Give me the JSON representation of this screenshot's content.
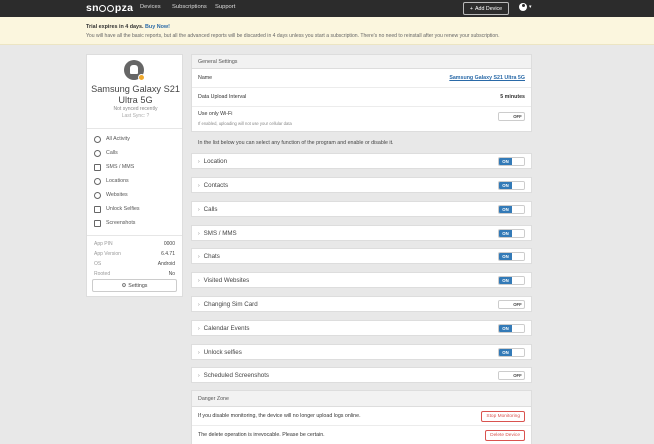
{
  "nav": {
    "logo": "snoopza",
    "links": [
      "Devices",
      "Subscriptions",
      "Support"
    ],
    "add_device": "Add Device",
    "add_icon": "+"
  },
  "banner": {
    "title": "Trial expires in 4 days.",
    "buy": "Buy Now!",
    "message": "You will have all the basic reports, but all the advanced reports will be discarded in 4 days unless you start a subscription. There's no need to reinstall after you renew your subscription."
  },
  "device": {
    "name": "Samsung Galaxy S21 Ultra 5G",
    "status": "Not synced recently",
    "last_sync": "Last Sync: ?",
    "icon": "android-icon"
  },
  "sidebar": {
    "items": [
      {
        "label": "All Activity",
        "icon": "clock-icon"
      },
      {
        "label": "Calls",
        "icon": "phone-icon"
      },
      {
        "label": "SMS / MMS",
        "icon": "message-icon"
      },
      {
        "label": "Locations",
        "icon": "location-icon"
      },
      {
        "label": "Websites",
        "icon": "globe-icon"
      },
      {
        "label": "Unlock Selfies",
        "icon": "camera-icon"
      },
      {
        "label": "Screenshots",
        "icon": "screen-icon"
      }
    ],
    "info": [
      {
        "key": "App PIN",
        "value": "0000"
      },
      {
        "key": "App Version",
        "value": "6.4.71"
      },
      {
        "key": "OS",
        "value": "Android"
      },
      {
        "key": "Rooted",
        "value": "No"
      }
    ],
    "settings_label": "Settings",
    "settings_icon": "⚙"
  },
  "general": {
    "header": "General Settings",
    "name_label": "Name",
    "name_value": "Samsung Galaxy S21 Ultra 5G",
    "interval_label": "Data Upload Interval",
    "interval_value": "5 minutes",
    "wifi_label": "Use only Wi-Fi",
    "wifi_hint": "If enabled, uploading will not use your cellular data",
    "wifi_state": "OFF"
  },
  "intro": "In the list below you can select any function of the program and enable or disable it.",
  "features": [
    {
      "label": "Location",
      "state": "ON"
    },
    {
      "label": "Contacts",
      "state": "ON"
    },
    {
      "label": "Calls",
      "state": "ON"
    },
    {
      "label": "SMS / MMS",
      "state": "ON"
    },
    {
      "label": "Chats",
      "state": "ON"
    },
    {
      "label": "Visited Websites",
      "state": "ON"
    },
    {
      "label": "Changing Sim Card",
      "state": "OFF"
    },
    {
      "label": "Calendar Events",
      "state": "ON"
    },
    {
      "label": "Unlock selfies",
      "state": "ON"
    },
    {
      "label": "Scheduled Screenshots",
      "state": "OFF"
    }
  ],
  "danger": {
    "header": "Danger Zone",
    "stop_text": "If you disable monitoring, the device will no longer upload logs online.",
    "stop_button": "Stop Monitoring",
    "delete_text": "The delete operation is irrevocable. Please be certain.",
    "delete_button": "Delete Device"
  },
  "colors": {
    "accent": "#337ab7",
    "danger": "#d9534f",
    "banner": "#fbf6de",
    "nav": "#2c2c2c"
  }
}
